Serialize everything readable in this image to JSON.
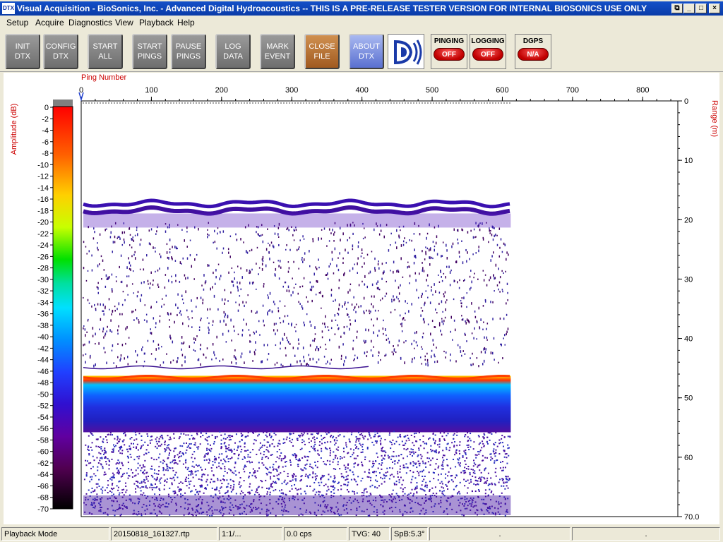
{
  "window": {
    "title": "Visual Acquisition  -  BioSonics, Inc.  -  Advanced Digital Hydroacoustics  -- THIS IS A PRE-RELEASE TESTER VERSION FOR INTERNAL BIOSONICS USE ONLY",
    "icon_text": "DTX",
    "controls": [
      "restore-icon",
      "minimize-icon",
      "maximize-icon",
      "close-icon"
    ]
  },
  "menu": [
    "Setup",
    "Acquire",
    "Diagnostics",
    "View",
    "Playback",
    "Help"
  ],
  "toolbar": {
    "buttons": [
      {
        "label": "INIT\nDTX"
      },
      {
        "label": "CONFIG\nDTX"
      },
      {
        "label": "START\nALL"
      },
      {
        "label": "START\nPINGS"
      },
      {
        "label": "PAUSE\nPINGS"
      },
      {
        "label": "LOG\nDATA"
      },
      {
        "label": "MARK\nEVENT"
      },
      {
        "label": "CLOSE\nFILE"
      },
      {
        "label": "ABOUT\nDTX"
      }
    ],
    "logo_icon": "biosonics-logo-icon",
    "indicators": [
      {
        "label": "PINGING",
        "state": "OFF"
      },
      {
        "label": "LOGGING",
        "state": "OFF"
      },
      {
        "label": "DGPS",
        "state": "N/A"
      }
    ]
  },
  "plot": {
    "x_axis_label": "Ping Number",
    "y_axis_label": "Range (m)",
    "colorbar_label": "Amplitude (dB)",
    "x_ticks": [
      0,
      100,
      200,
      300,
      400,
      500,
      600,
      700,
      800
    ],
    "y_ticks": [
      "0",
      "10",
      "20",
      "30",
      "40",
      "50",
      "60",
      "70.0"
    ],
    "colorbar_ticks": [
      0,
      -2,
      -4,
      -6,
      -8,
      -10,
      -12,
      -14,
      -16,
      -18,
      -20,
      -22,
      -24,
      -26,
      -28,
      -30,
      -32,
      -34,
      -36,
      -38,
      -40,
      -42,
      -44,
      -46,
      -48,
      -50,
      -52,
      -54,
      -56,
      -58,
      -60,
      -62,
      -64,
      -66,
      -68,
      -70
    ],
    "x_range": [
      0,
      850
    ],
    "range_limits": [
      0,
      70
    ],
    "ping_count": 612,
    "bottom_range_m": 47,
    "surface_layer_range_m": 18,
    "colors": {
      "palette_hi": "#ff0000",
      "palette_mid": "#00c0ff",
      "palette_lo": "#400080",
      "axis_label": "#cc0000"
    }
  },
  "status": {
    "mode": "Playback Mode",
    "file": "20150818_161327.rtp",
    "ratio": "1:1/...",
    "rate": "0.0 cps",
    "tvg": "TVG: 40",
    "spb": "SpB:5.3°",
    "f1": ".",
    "f2": "."
  }
}
